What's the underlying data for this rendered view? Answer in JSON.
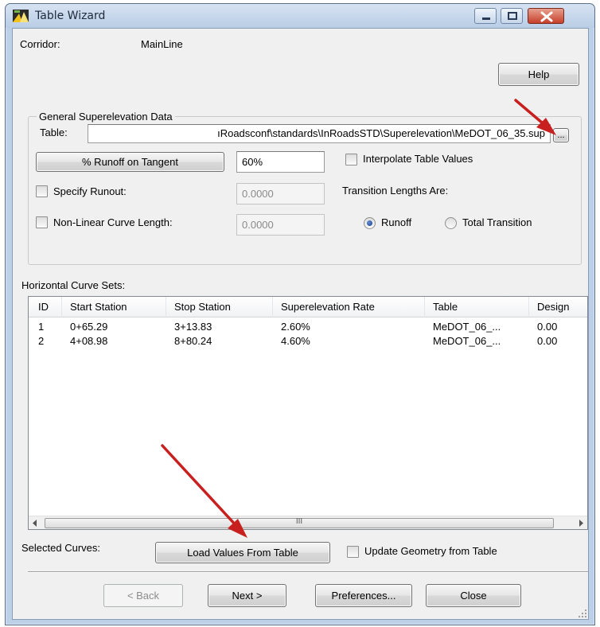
{
  "window": {
    "title": "Table Wizard"
  },
  "corridor": {
    "label": "Corridor:",
    "value": "MainLine"
  },
  "help_button": "Help",
  "general": {
    "group_title": "General Superelevation Data",
    "table_label": "Table:",
    "table_path": "ıRoadsconf\\standards\\InRoadsSTD\\Superelevation\\MeDOT_06_35.sup",
    "browse_button": "...",
    "runoff_button": "% Runoff on Tangent",
    "runoff_value": "60%",
    "interpolate_label": "Interpolate Table Values",
    "interpolate_checked": false,
    "specify_runout_label": "Specify Runout:",
    "specify_runout_checked": false,
    "specify_runout_value": "0.0000",
    "nonlinear_label": "Non-Linear Curve Length:",
    "nonlinear_checked": false,
    "nonlinear_value": "0.0000",
    "transition_label": "Transition Lengths Are:",
    "transition_options": [
      "Runoff",
      "Total Transition"
    ],
    "transition_selected": "Runoff"
  },
  "curve_sets": {
    "label": "Horizontal Curve Sets:",
    "columns": [
      "ID",
      "Start Station",
      "Stop Station",
      "Superelevation Rate",
      "Table",
      "Design"
    ],
    "rows": [
      [
        "1",
        "0+65.29",
        "3+13.83",
        "2.60%",
        "MeDOT_06_...",
        "0.00"
      ],
      [
        "2",
        "4+08.98",
        "8+80.24",
        "4.60%",
        "MeDOT_06_...",
        "0.00"
      ]
    ],
    "scroll_grip": "III"
  },
  "selected_curves": {
    "label": "Selected Curves:",
    "load_button": "Load Values From Table",
    "update_label": "Update Geometry from Table",
    "update_checked": false
  },
  "footer": {
    "back": "< Back",
    "next": "Next >",
    "preferences": "Preferences...",
    "close": "Close"
  },
  "colors": {
    "annotation_arrow": "#c8201e",
    "window_frame": "#bcd0e8",
    "client_bg": "#f0f0f0"
  },
  "icons": {
    "app": "inroads-app-icon",
    "minimize": "minimize-icon",
    "maximize": "maximize-icon",
    "close": "close-icon"
  }
}
